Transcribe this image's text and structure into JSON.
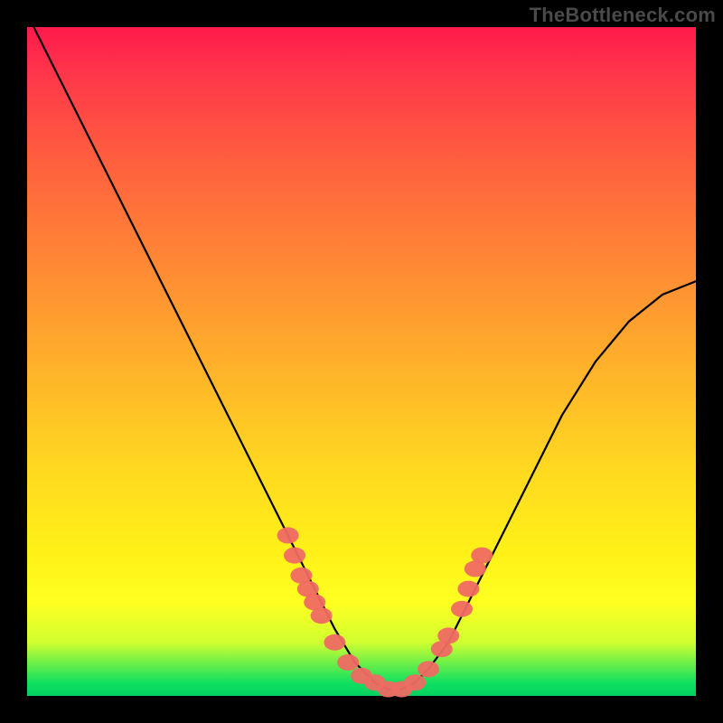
{
  "watermark": "TheBottleneck.com",
  "gradient": {
    "top": "#ff1a4d",
    "bottom": "#00d060"
  },
  "chart_data": {
    "type": "line",
    "title": "",
    "xlabel": "",
    "ylabel": "",
    "xlim": [
      0,
      100
    ],
    "ylim": [
      0,
      100
    ],
    "grid": false,
    "series": [
      {
        "name": "curve",
        "color": "#000000",
        "x": [
          1,
          5,
          10,
          15,
          20,
          25,
          30,
          35,
          40,
          43,
          46,
          49,
          52,
          54,
          56,
          58,
          60,
          63,
          66,
          70,
          75,
          80,
          85,
          90,
          95,
          100
        ],
        "y": [
          100,
          92,
          82,
          72,
          62,
          52,
          42,
          32,
          22,
          16,
          10,
          5,
          2,
          1,
          1,
          2,
          4,
          8,
          14,
          22,
          32,
          42,
          50,
          56,
          60,
          62
        ]
      }
    ],
    "highlight_points": {
      "name": "markers",
      "color": "#ef6a63",
      "marker": "oblong",
      "points": [
        {
          "x": 39,
          "y": 24
        },
        {
          "x": 40,
          "y": 21
        },
        {
          "x": 41,
          "y": 18
        },
        {
          "x": 42,
          "y": 16
        },
        {
          "x": 43,
          "y": 14
        },
        {
          "x": 44,
          "y": 12
        },
        {
          "x": 46,
          "y": 8
        },
        {
          "x": 48,
          "y": 5
        },
        {
          "x": 50,
          "y": 3
        },
        {
          "x": 52,
          "y": 2
        },
        {
          "x": 54,
          "y": 1
        },
        {
          "x": 56,
          "y": 1
        },
        {
          "x": 58,
          "y": 2
        },
        {
          "x": 60,
          "y": 4
        },
        {
          "x": 62,
          "y": 7
        },
        {
          "x": 63,
          "y": 9
        },
        {
          "x": 65,
          "y": 13
        },
        {
          "x": 66,
          "y": 16
        },
        {
          "x": 67,
          "y": 19
        },
        {
          "x": 68,
          "y": 21
        }
      ]
    }
  }
}
